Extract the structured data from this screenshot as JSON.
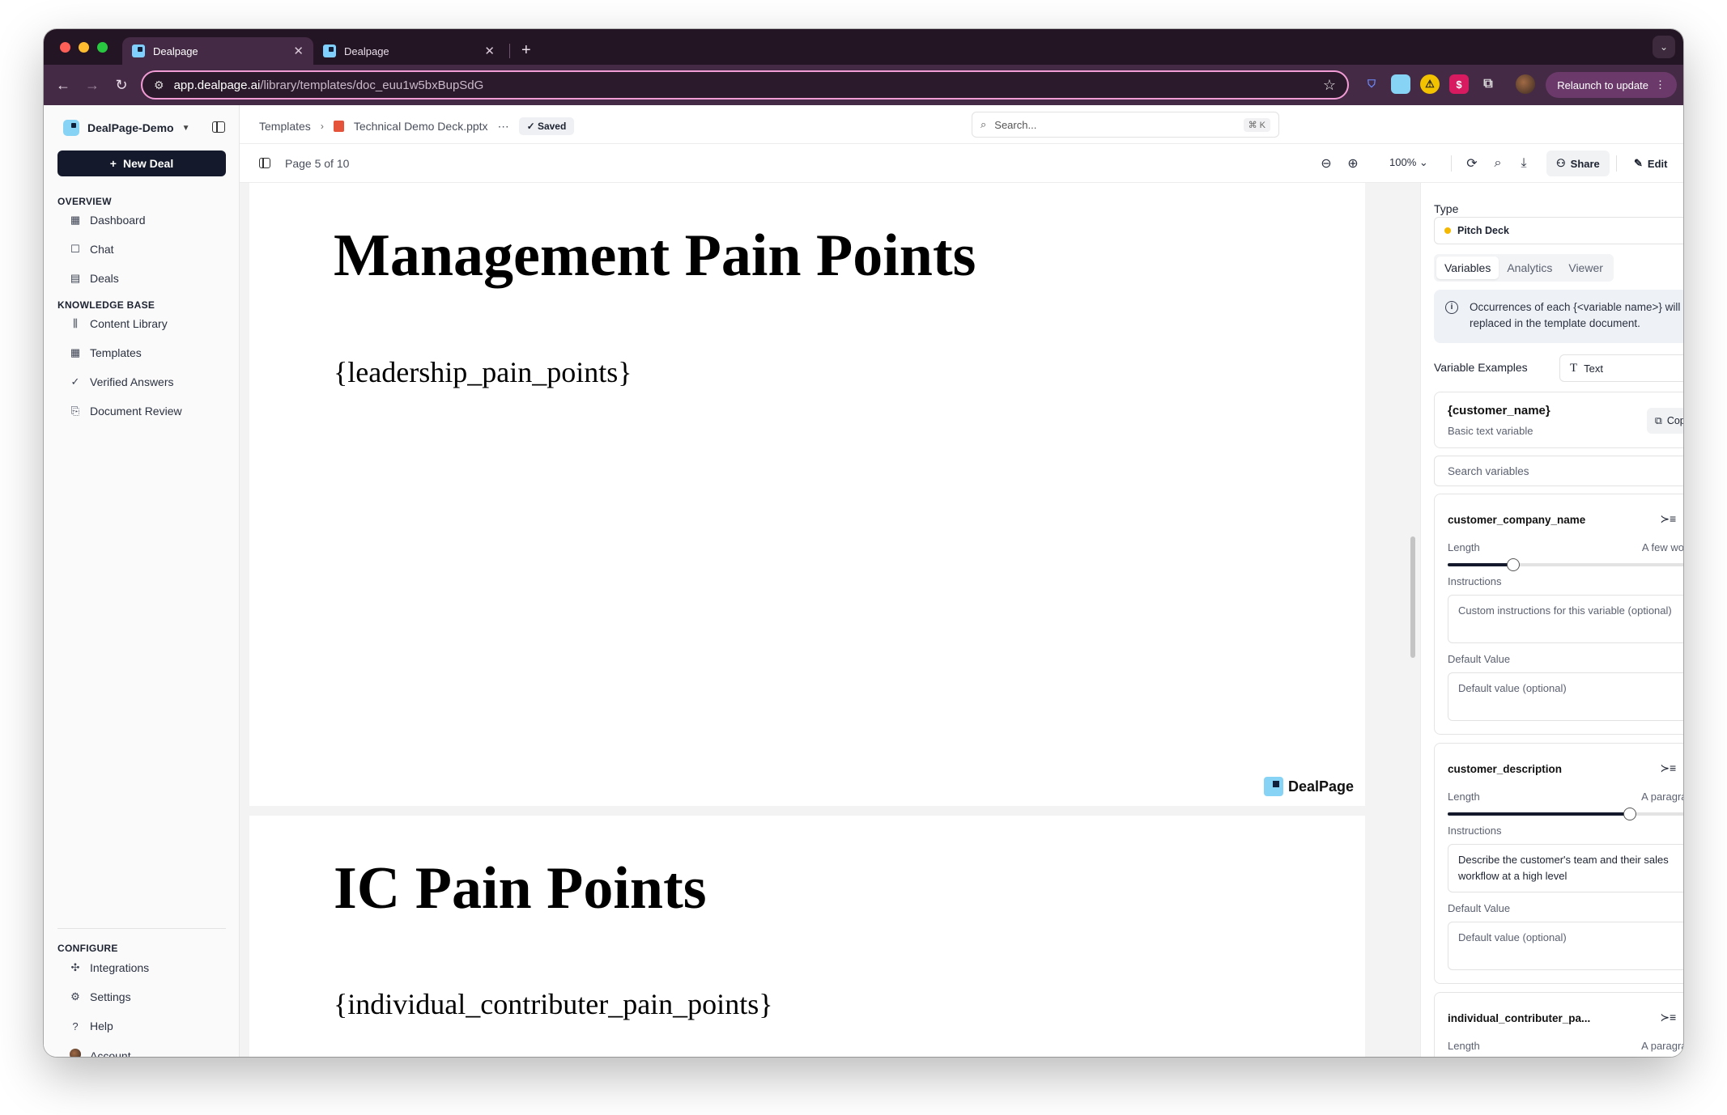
{
  "browser": {
    "tabs": [
      {
        "title": "Dealpage",
        "active": true
      },
      {
        "title": "Dealpage",
        "active": false
      }
    ],
    "url_host": "app.dealpage.ai",
    "url_path": "/library/templates/doc_euu1w5bxBupSdG",
    "relaunch_label": "Relaunch to update"
  },
  "sidebar": {
    "workspace": "DealPage-Demo",
    "new_deal": "New Deal",
    "overview_label": "OVERVIEW",
    "overview_items": [
      {
        "label": "Dashboard",
        "icon": "dashboard-icon"
      },
      {
        "label": "Chat",
        "icon": "chat-icon"
      },
      {
        "label": "Deals",
        "icon": "deals-icon"
      }
    ],
    "kb_label": "KNOWLEDGE BASE",
    "kb_items": [
      {
        "label": "Content Library",
        "icon": "library-icon"
      },
      {
        "label": "Templates",
        "icon": "templates-icon"
      },
      {
        "label": "Verified Answers",
        "icon": "verified-icon"
      },
      {
        "label": "Document Review",
        "icon": "review-icon"
      }
    ],
    "configure_label": "CONFIGURE",
    "configure_items": [
      {
        "label": "Integrations",
        "icon": "puzzle-icon"
      },
      {
        "label": "Settings",
        "icon": "gear-icon"
      },
      {
        "label": "Help",
        "icon": "help-icon"
      },
      {
        "label": "Account",
        "icon": "avatar"
      }
    ]
  },
  "header": {
    "crumb_root": "Templates",
    "crumb_file": "Technical Demo Deck.pptx",
    "saved": "Saved",
    "search_placeholder": "Search...",
    "search_kbd": "⌘ K"
  },
  "toolbar": {
    "page_indicator": "Page 5 of 10",
    "zoom": "100%",
    "share": "Share",
    "edit": "Edit"
  },
  "slides": [
    {
      "title": "Management Pain Points",
      "variable": "{leadership_pain_points}",
      "brand": "DealPage"
    },
    {
      "title": "IC Pain Points",
      "variable": "{individual_contributer_pain_points}"
    }
  ],
  "panel": {
    "type_label": "Type",
    "type_value": "Pitch Deck",
    "type_color": "#f5b800",
    "tabs": [
      "Variables",
      "Analytics",
      "Viewer"
    ],
    "active_tab": "Variables",
    "info_text": "Occurrences of each {<variable name>} will be replaced in the template document.",
    "examples_label": "Variable Examples",
    "examples_select": "Text",
    "example_name": "{customer_name}",
    "example_desc": "Basic text variable",
    "copy_label": "Copy",
    "search_vars_placeholder": "Search variables",
    "length_label": "Length",
    "instructions_label": "Instructions",
    "default_label": "Default Value",
    "instructions_placeholder": "Custom instructions for this variable (optional)",
    "default_placeholder": "Default value (optional)",
    "variables": [
      {
        "name": "customer_company_name",
        "length_value": "A few words",
        "length_level": 0.26,
        "instructions": ""
      },
      {
        "name": "customer_description",
        "length_value": "A paragraph",
        "length_level": 0.72,
        "instructions": "Describe the customer's team and their sales workflow at a high level"
      },
      {
        "name": "individual_contributer_pa...",
        "length_value": "A paragraph"
      }
    ]
  }
}
